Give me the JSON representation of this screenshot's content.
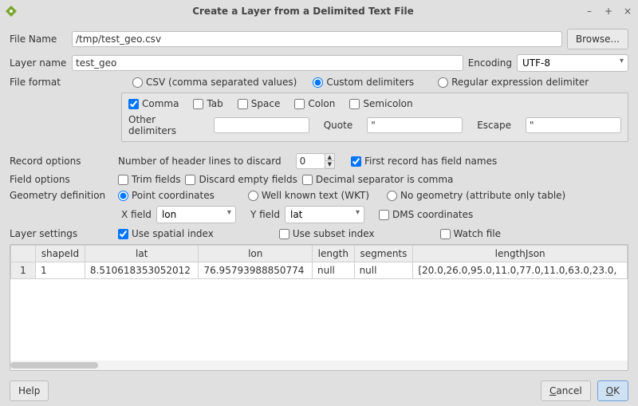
{
  "window": {
    "title": "Create a Layer from a Delimited Text File"
  },
  "labels": {
    "file_name": "File Name",
    "layer_name": "Layer name",
    "encoding": "Encoding",
    "file_format": "File format",
    "other_delimiters": "Other delimiters",
    "quote": "Quote",
    "escape": "Escape",
    "record_options": "Record options",
    "header_lines": "Number of header lines to discard",
    "first_record_names": "First record has field names",
    "field_options": "Field options",
    "geometry_def": "Geometry definition",
    "x_field": "X field",
    "y_field": "Y field",
    "dms": "DMS coordinates",
    "layer_settings": "Layer settings"
  },
  "buttons": {
    "browse": "Browse...",
    "help": "Help",
    "cancel_u": "C",
    "cancel_rest": "ancel",
    "ok_u": "O",
    "ok_rest": "K"
  },
  "values": {
    "file_name": "/tmp/test_geo.csv",
    "layer_name": "test_geo",
    "encoding": "UTF-8",
    "quote": "\"",
    "escape": "\"",
    "header_lines": "0",
    "x_field": "lon",
    "y_field": "lat"
  },
  "file_format": {
    "csv": "CSV (comma separated values)",
    "custom": "Custom delimiters",
    "regex": "Regular expression delimiter"
  },
  "delims": {
    "comma": "Comma",
    "tab": "Tab",
    "space": "Space",
    "colon": "Colon",
    "semicolon": "Semicolon"
  },
  "field_opts": {
    "trim": "Trim fields",
    "discard_empty": "Discard empty fields",
    "decimal_comma": "Decimal separator is comma"
  },
  "geom": {
    "point": "Point coordinates",
    "wkt": "Well known text (WKT)",
    "none": "No geometry (attribute only table)"
  },
  "layer": {
    "spatial_index": "Use spatial index",
    "subset_index": "Use subset index",
    "watch_file": "Watch file"
  },
  "table": {
    "headers": [
      "shapeId",
      "lat",
      "lon",
      "length",
      "segments",
      "lengthJson"
    ],
    "rows": [
      {
        "n": "1",
        "cells": [
          "1",
          "8.510618353052012",
          "76.95793988850774",
          "null",
          "null",
          "[20.0,26.0,95.0,11.0,77.0,11.0,63.0,23.0,"
        ]
      }
    ]
  }
}
